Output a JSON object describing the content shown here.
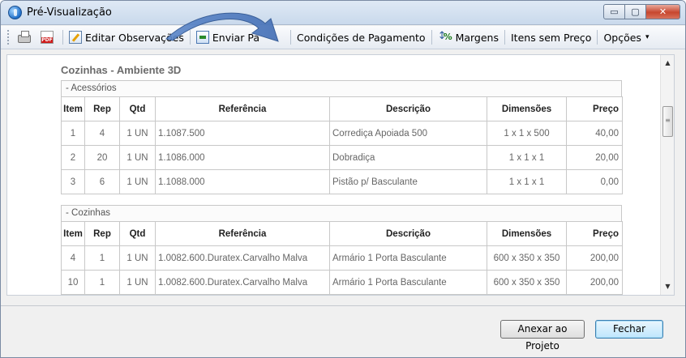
{
  "window": {
    "title": "Pré-Visualização",
    "controls": {
      "minimize": "▭",
      "maximize": "▢",
      "close": "✕"
    }
  },
  "toolbar": {
    "print_icon": "printer-icon",
    "pdf_icon": "pdf-icon",
    "edit_notes": "Editar Observações",
    "send": "Enviar Pa",
    "payment": "Condições de Pagamento",
    "margins": "Margens",
    "items_no_price": "Itens sem Preço",
    "options": "Opções",
    "options_caret": "▾"
  },
  "document": {
    "section_title": "Cozinhas - Ambiente 3D",
    "columns": [
      "Item",
      "Rep",
      "Qtd",
      "Referência",
      "Descrição",
      "Dimensões",
      "Preço"
    ],
    "groups": [
      {
        "name": "- Acessórios",
        "rows": [
          [
            "1",
            "4",
            "1 UN",
            "1.1087.500",
            "Corrediça Apoiada 500",
            "1 x 1 x 500",
            "40,00"
          ],
          [
            "2",
            "20",
            "1 UN",
            "1.1086.000",
            "Dobradiça",
            "1 x 1 x 1",
            "20,00"
          ],
          [
            "3",
            "6",
            "1 UN",
            "1.1088.000",
            "Pistão p/ Basculante",
            "1 x 1 x 1",
            "0,00"
          ]
        ]
      },
      {
        "name": "- Cozinhas",
        "rows": [
          [
            "4",
            "1",
            "1 UN",
            "1.0082.600.Duratex.Carvalho Malva",
            "Armário 1 Porta Basculante",
            "600 x 350 x 350",
            "200,00"
          ],
          [
            "10",
            "1",
            "1 UN",
            "1.0082.600.Duratex.Carvalho Malva",
            "Armário 1 Porta Basculante",
            "600 x 350 x 350",
            "200,00"
          ]
        ]
      }
    ]
  },
  "scrollbar": {
    "up": "▲",
    "down": "▼",
    "grip": "≡"
  },
  "footer": {
    "attach_button": "Anexar ao Projeto",
    "close_button": "Fechar"
  },
  "colors": {
    "accent": "#3c7fb1",
    "arrow": "#5b86c8"
  }
}
